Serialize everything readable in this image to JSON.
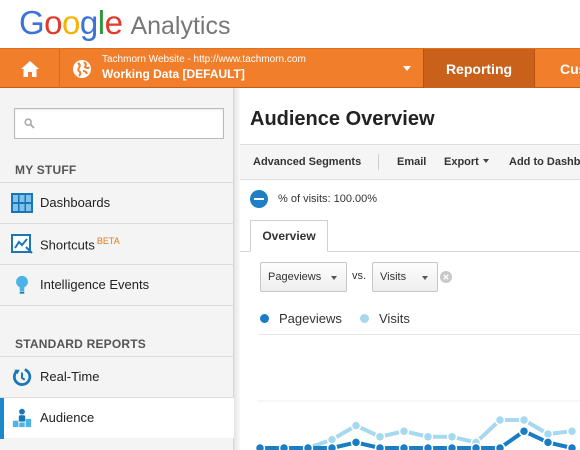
{
  "logo": {
    "letters": [
      {
        "ch": "G",
        "color": "#3b73d8"
      },
      {
        "ch": "o",
        "color": "#df3b2c"
      },
      {
        "ch": "o",
        "color": "#f4b400"
      },
      {
        "ch": "g",
        "color": "#3b73d8"
      },
      {
        "ch": "l",
        "color": "#2b9a3e"
      },
      {
        "ch": "e",
        "color": "#df3b2c"
      }
    ],
    "product": "Analytics"
  },
  "nav": {
    "home_icon": "home-icon",
    "account": {
      "site": "Tachmorn Website - http://www.tachmorn.com",
      "view": "Working Data [DEFAULT]"
    },
    "tabs": [
      {
        "label": "Reporting",
        "active": true
      },
      {
        "label": "Cus"
      }
    ]
  },
  "sidebar": {
    "search_placeholder": "",
    "my_stuff_heading": "MY STUFF",
    "my_stuff_items": [
      {
        "label": "Dashboards",
        "icon": "dashboards-icon"
      },
      {
        "label": "Shortcuts",
        "icon": "shortcuts-icon",
        "badge": "BETA"
      },
      {
        "label": "Intelligence Events",
        "icon": "intelligence-bulb-icon"
      }
    ],
    "standard_heading": "STANDARD REPORTS",
    "standard_items": [
      {
        "label": "Real-Time",
        "icon": "realtime-icon"
      },
      {
        "label": "Audience",
        "icon": "audience-icon",
        "active": true
      }
    ]
  },
  "main": {
    "title": "Audience Overview",
    "toolbar": {
      "advanced_segments": "Advanced Segments",
      "email": "Email",
      "export": "Export",
      "add_to_dashboard": "Add to Dashb"
    },
    "segment_text": "% of visits: 100.00%",
    "tab_overview": "Overview",
    "metric_primary": "Pageviews",
    "vs_text": "vs.",
    "metric_secondary": "Visits",
    "legend": [
      {
        "label": "Pageviews",
        "color": "#1a7cc2"
      },
      {
        "label": "Visits",
        "color": "#a6d8f0"
      }
    ]
  },
  "chart_data": {
    "type": "line",
    "series": [
      {
        "name": "Pageviews",
        "color": "#1a7cc2",
        "values": [
          0,
          0,
          0,
          0,
          2,
          0,
          0,
          0,
          0,
          0,
          0,
          6,
          2,
          0
        ]
      },
      {
        "name": "Visits",
        "color": "#a6d8f0",
        "values": [
          0,
          0,
          0,
          3,
          8,
          4,
          6,
          4,
          4,
          2,
          10,
          10,
          5,
          6
        ]
      }
    ],
    "ylim": [
      0,
      10
    ],
    "grid": false
  }
}
